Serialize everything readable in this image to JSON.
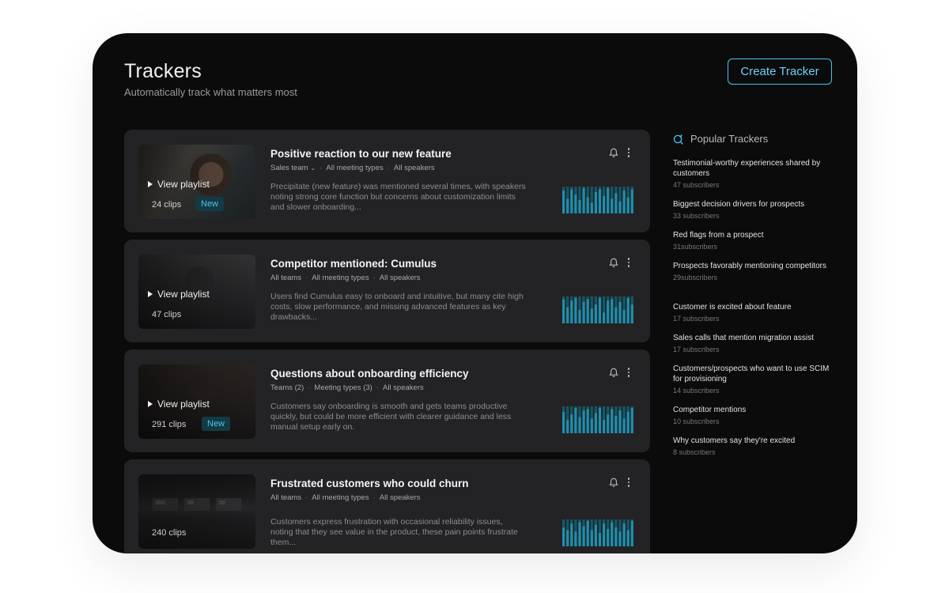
{
  "header": {
    "title": "Trackers",
    "subtitle": "Automatically track what matters most",
    "create_button": "Create Tracker"
  },
  "trackers": [
    {
      "title": "Positive reaction to our new feature",
      "meta": [
        "Sales team",
        "All meeting types",
        "All speakers"
      ],
      "meta_has_dropdown": true,
      "description": "Precipitate (new feature) was mentioned several times, with speakers noting strong core function but concerns about customization limits and slower onboarding...",
      "playlist_label": "View playlist",
      "clips": "24 clips",
      "badge": "New",
      "activity": [
        0.85,
        0.55,
        0.9,
        0.7,
        0.5,
        0.95,
        0.6,
        0.4,
        0.8,
        0.9,
        0.65,
        0.95,
        0.55,
        0.75,
        0.45,
        0.85,
        0.6,
        0.9
      ]
    },
    {
      "title": "Competitor mentioned: Cumulus",
      "meta": [
        "All teams",
        "All meeting types",
        "All speakers"
      ],
      "meta_has_dropdown": false,
      "description": "Users find Cumulus easy to onboard and intuitive, but many cite high costs, slow performance, and missing advanced features as key drawbacks...",
      "playlist_label": "View playlist",
      "clips": "47 clips",
      "badge": "",
      "activity": [
        0.9,
        0.6,
        0.85,
        0.95,
        0.5,
        0.8,
        0.9,
        0.55,
        0.7,
        0.95,
        0.4,
        0.85,
        0.9,
        0.6,
        0.8,
        0.5,
        0.95,
        0.7
      ]
    },
    {
      "title": "Questions about onboarding efficiency",
      "meta": [
        "Teams (2)",
        "Meeting types (3)",
        "All speakers"
      ],
      "meta_has_dropdown": false,
      "description": "Customers say onboarding is smooth and gets teams productive quickly, but could be more efficient with clearer guidance and less manual setup early on.",
      "playlist_label": "View playlist",
      "clips": "291 clips",
      "badge": "New",
      "activity": [
        0.8,
        0.5,
        0.7,
        0.95,
        0.6,
        0.85,
        0.9,
        0.55,
        0.75,
        0.95,
        0.5,
        0.7,
        0.9,
        0.65,
        0.85,
        0.55,
        0.8,
        0.95
      ]
    },
    {
      "title": "Frustrated customers who could churn",
      "meta": [
        "All teams",
        "All meeting types",
        "All speakers"
      ],
      "meta_has_dropdown": false,
      "description": "Customers express frustration with occasional reliability issues, noting that they see value in the product, these pain points frustrate them...",
      "playlist_label": "",
      "clips": "240 clips",
      "badge": "",
      "activity": [
        0.7,
        0.6,
        0.85,
        0.55,
        0.9,
        0.75,
        0.95,
        0.6,
        0.8,
        0.5,
        0.85,
        0.65,
        0.9,
        0.7,
        0.55,
        0.85,
        0.6,
        0.95
      ]
    }
  ],
  "popular": {
    "title": "Popular Trackers",
    "items": [
      {
        "name": "Testimonial-worthy experiences shared by customers",
        "subs": "47 subscribers"
      },
      {
        "name": "Biggest decision drivers for prospects",
        "subs": "33 subscribers"
      },
      {
        "name": "Red flags from a prospect",
        "subs": "31subscribers"
      },
      {
        "name": "Prospects favorably mentioning competitors",
        "subs": "29subscribers"
      },
      {
        "name": "Customer is excited about feature",
        "subs": "17 subscribers"
      },
      {
        "name": "Sales calls that mention migration assist",
        "subs": "17 subscribers"
      },
      {
        "name": "Customers/prospects who want to use SCIM for provisioning",
        "subs": "14 subscribers"
      },
      {
        "name": "Competitor mentions",
        "subs": "10 subscribers"
      },
      {
        "name": "Why customers say they're excited",
        "subs": "8 subscribers"
      }
    ]
  },
  "colors": {
    "accent": "#4cc3f2",
    "bar_bright": "#1e8fae",
    "bar_dim": "#145868",
    "card_bg": "#232325",
    "panel_bg": "#0b0b0c"
  },
  "icons": {
    "bell": "bell-icon",
    "more": "more-vertical-icon",
    "play": "play-icon",
    "sparkle": "sparkle-search-icon"
  }
}
